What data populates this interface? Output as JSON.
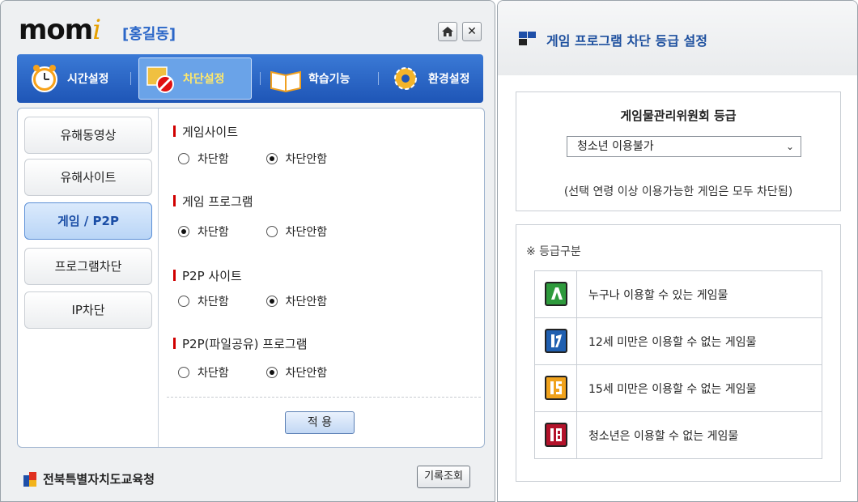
{
  "left": {
    "logo": "mom",
    "logo_i": "i",
    "username": "[홍길동]",
    "home_icon": "home-icon",
    "close_label": "✕",
    "nav": [
      {
        "label": "시간설정",
        "icon": "clock-icon"
      },
      {
        "label": "차단설정",
        "icon": "block-icon",
        "active": true
      },
      {
        "label": "학습기능",
        "icon": "book-icon"
      },
      {
        "label": "환경설정",
        "icon": "gear-icon"
      }
    ],
    "sidebar": [
      {
        "label": "유해동영상"
      },
      {
        "label": "유해사이트"
      },
      {
        "label": "게임 / P2P",
        "active": true
      },
      {
        "label": "프로그램차단"
      },
      {
        "label": "IP차단"
      }
    ],
    "sections": [
      {
        "title": "게임사이트",
        "opt1": "차단함",
        "opt2": "차단안함",
        "selected": "차단안함"
      },
      {
        "title": "게임 프로그램",
        "opt1": "차단함",
        "opt2": "차단안함",
        "selected": "차단함"
      },
      {
        "title": "P2P 사이트",
        "opt1": "차단함",
        "opt2": "차단안함",
        "selected": "차단안함"
      },
      {
        "title": "P2P(파일공유) 프로그램",
        "opt1": "차단함",
        "opt2": "차단안함",
        "selected": "차단안함"
      }
    ],
    "apply_label": "적 용",
    "org_name": "전북특별자치도교육청",
    "history_label": "기록조회"
  },
  "right": {
    "title": "게임 프로그램 차단 등급 설정",
    "rating_heading": "게임물관리위원회 등급",
    "rating_selected": "청소년 이용불가",
    "rating_note": "(선택 연령 이상 이용가능한 게임은 모두 차단됨)",
    "class_title": "※ 등급구분",
    "classes": [
      {
        "mark": "ALL",
        "text": "누구나 이용할 수 있는 게임물",
        "color": "#2e9a3c"
      },
      {
        "mark": "12",
        "text": "12세 미만은 이용할 수 없는 게임물",
        "color": "#1f5fb0"
      },
      {
        "mark": "15",
        "text": "15세 미만은 이용할 수 없는 게임물",
        "color": "#f0a21c"
      },
      {
        "mark": "18",
        "text": "청소년은 이용할 수 없는 게임물",
        "color": "#b3122a"
      }
    ]
  }
}
